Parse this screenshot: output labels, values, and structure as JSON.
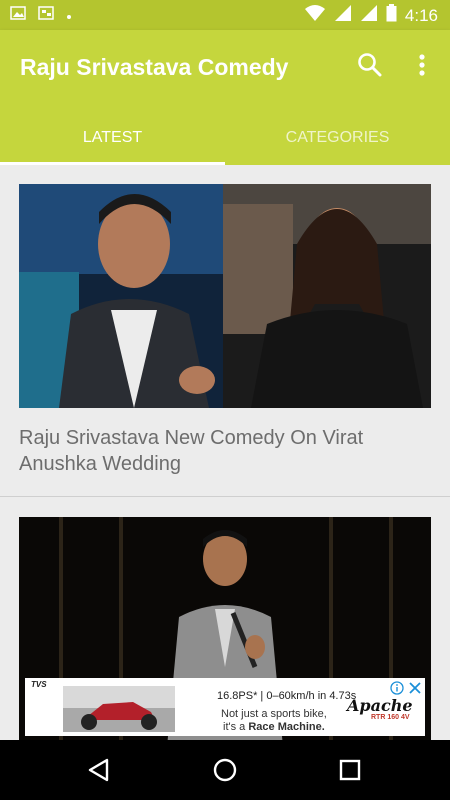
{
  "status_bar": {
    "time": "4:16",
    "left_icons": [
      "image-icon",
      "cast-icon",
      "dot-icon"
    ],
    "right_icons": [
      "wifi-icon",
      "signal-icon",
      "signal-icon",
      "battery-icon"
    ]
  },
  "app_bar": {
    "title": "Raju Srivastava Comedy",
    "actions": [
      "search-icon",
      "more-vert-icon"
    ]
  },
  "tabs": [
    {
      "label": "LATEST",
      "selected": true
    },
    {
      "label": "CATEGORIES",
      "selected": false
    }
  ],
  "feed": [
    {
      "title": "Raju Srivastava New Comedy On Virat Anushka Wedding"
    },
    {
      "title": ""
    }
  ],
  "ad": {
    "brand": "TVS",
    "headline": "16.8PS* | 0–60km/h in 4.73s",
    "line2": "Not just a sports bike,",
    "line3_prefix": "it's a ",
    "line3_bold": "Race Machine.",
    "logo_text": "Apache",
    "logo_sub": "RTR 160 4V"
  },
  "nav_bar": {
    "buttons": [
      "back-icon",
      "home-icon",
      "recents-icon"
    ]
  },
  "colors": {
    "status_bar": "#b4c52f",
    "app_bar": "#c5d63d",
    "background": "#ececec",
    "title_text": "#6d6d6d"
  }
}
